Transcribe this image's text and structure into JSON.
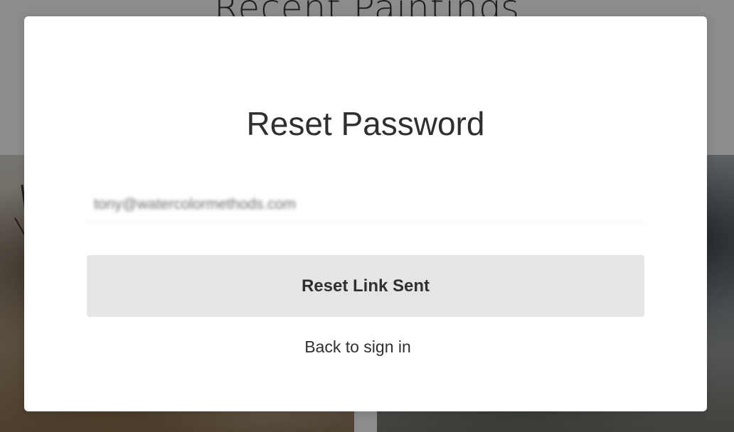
{
  "background": {
    "title": "Recent Paintings"
  },
  "modal": {
    "title": "Reset Password",
    "email_value": "tony@watercolormethods.com",
    "button_label": "Reset Link Sent",
    "back_link_label": "Back to sign in"
  },
  "colors": {
    "overlay": "#000000",
    "button_bg": "#e5e5e5",
    "text": "#2f2f2f",
    "field_border": "#dcdcdc"
  }
}
